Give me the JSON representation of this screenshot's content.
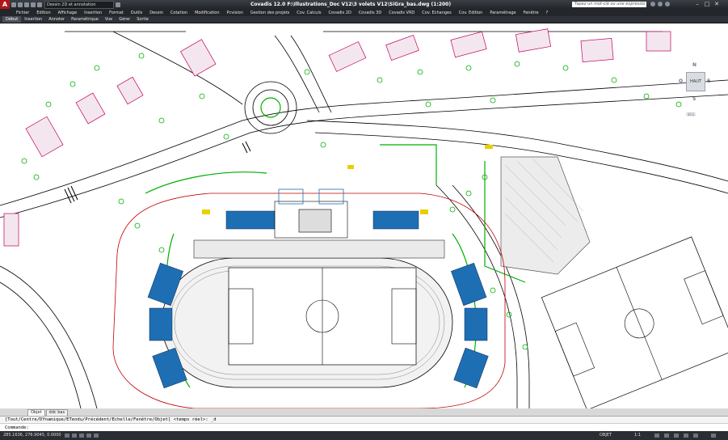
{
  "titlebar": {
    "app_logo": "A",
    "workspace": "Dessin 2D et annotation",
    "title": "Covadis 12.0    F:\\Illustrations_Doc V12\\3 volets V12\\SiGra_bas.dwg (1:200)",
    "search_placeholder": "Tapez un mot-clé ou une expressio"
  },
  "menu": [
    "Fichier",
    "Edition",
    "Affichage",
    "Insertion",
    "Format",
    "Outils",
    "Dessin",
    "Cotation",
    "Modification",
    "Pcvision",
    "Gestion des projets",
    "Cov. Calculs",
    "Covadis 2D",
    "Covadis 3D",
    "Covadis VRD",
    "Cov. Echanges",
    "Cov. Edition",
    "Paramétrage",
    "Fenêtre",
    "?"
  ],
  "ribbon_tabs": [
    {
      "label": "Début",
      "active": true
    },
    {
      "label": "Insertion",
      "active": false
    },
    {
      "label": "Annoter",
      "active": false
    },
    {
      "label": "Paramétrique",
      "active": false
    },
    {
      "label": "Vue",
      "active": false
    },
    {
      "label": "Gérer",
      "active": false
    },
    {
      "label": "Sortie",
      "active": false
    }
  ],
  "viewcube": {
    "north": "N",
    "south": "S",
    "east": "E",
    "west": "O",
    "face": "HAUT",
    "ucs": "SCG"
  },
  "layout_tabs": [
    {
      "label": "Objet",
      "active": true
    },
    {
      "label": "ddc bas",
      "active": false
    }
  ],
  "command": {
    "history": "[Tout/Centre/DYnamique/ETendu/Précédent/Echelle/Fenêtre/Objet] <temps réel>: _d",
    "prompt": "Commande:"
  },
  "status": {
    "coordinates": "285.1636, 276.9045, 0.0000",
    "objet": "OBJET",
    "scale": "1:1"
  },
  "colors": {
    "canvas": "#ffffff",
    "vegetation": "#00b000",
    "buildings": "#c00060",
    "seating": "#1e6eb4",
    "roads": "#000000",
    "ui_dark": "#23272c"
  }
}
